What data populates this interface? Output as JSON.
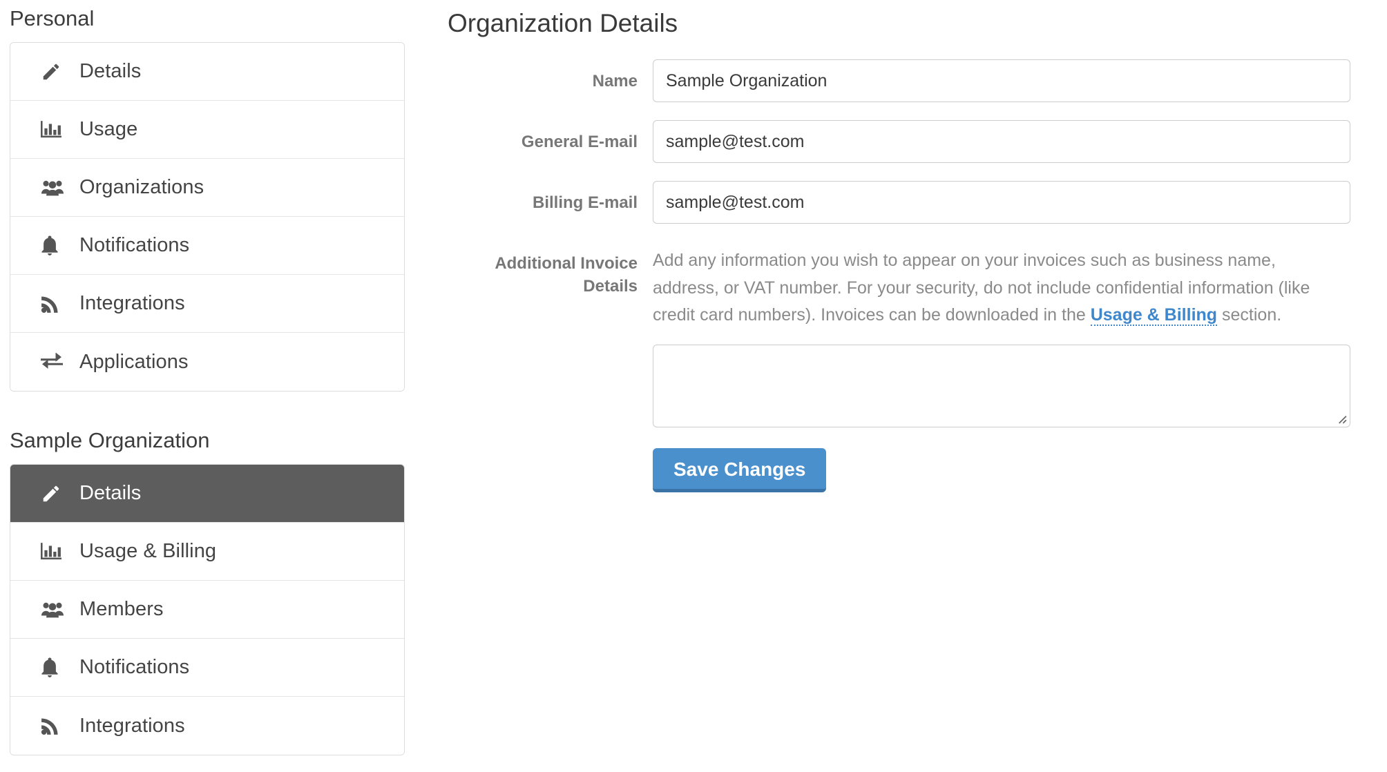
{
  "sidebar": {
    "sections": [
      {
        "heading": "Personal",
        "items": [
          {
            "label": "Details",
            "icon": "pencil-icon",
            "active": false
          },
          {
            "label": "Usage",
            "icon": "bar-chart-icon",
            "active": false
          },
          {
            "label": "Organizations",
            "icon": "users-group-icon",
            "active": false
          },
          {
            "label": "Notifications",
            "icon": "bell-icon",
            "active": false
          },
          {
            "label": "Integrations",
            "icon": "rss-icon",
            "active": false
          },
          {
            "label": "Applications",
            "icon": "exchange-arrows-icon",
            "active": false
          }
        ]
      },
      {
        "heading": "Sample Organization",
        "items": [
          {
            "label": "Details",
            "icon": "pencil-icon",
            "active": true
          },
          {
            "label": "Usage & Billing",
            "icon": "bar-chart-icon",
            "active": false
          },
          {
            "label": "Members",
            "icon": "users-group-icon",
            "active": false
          },
          {
            "label": "Notifications",
            "icon": "bell-icon",
            "active": false
          },
          {
            "label": "Integrations",
            "icon": "rss-icon",
            "active": false
          }
        ]
      }
    ]
  },
  "main": {
    "title": "Organization Details",
    "fields": {
      "name": {
        "label": "Name",
        "value": "Sample Organization",
        "placeholder": ""
      },
      "general_email": {
        "label": "General E-mail",
        "value": "sample@test.com",
        "placeholder": ""
      },
      "billing_email": {
        "label": "Billing E-mail",
        "value": "sample@test.com",
        "placeholder": ""
      },
      "invoice_details": {
        "label": "Additional Invoice Details",
        "help_part1": "Add any information you wish to appear on your invoices such as business name, address, or VAT number. For your security, do not include confidential information (like credit card numbers). Invoices can be downloaded in the ",
        "help_link": "Usage & Billing",
        "help_part2": " section.",
        "value": "",
        "placeholder": ""
      }
    },
    "save_label": "Save Changes"
  },
  "colors": {
    "accent_blue": "#4a90cd",
    "accent_blue_dark": "#3a73a5",
    "link_blue": "#3f87cc",
    "active_nav_bg": "#5d5d5d",
    "border": "#cccccc"
  }
}
